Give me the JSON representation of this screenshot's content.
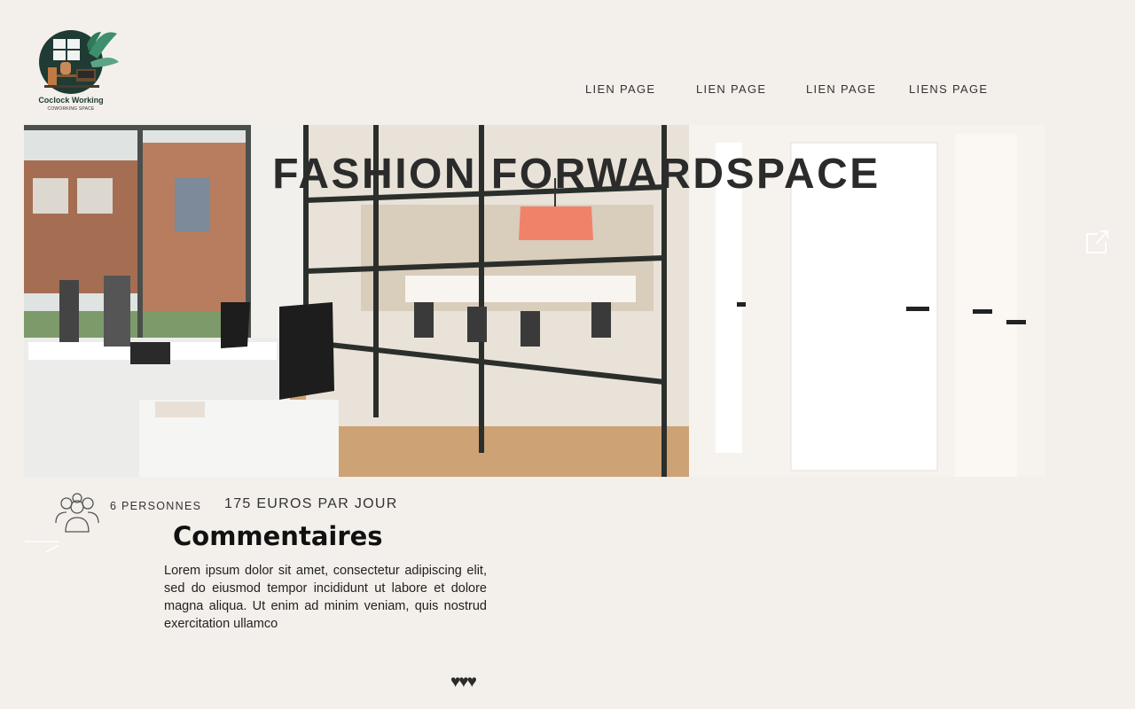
{
  "brand": {
    "logo_icon": "coworking-desk-logo",
    "name": "Coclock Working",
    "tagline": "COWORKING SPACE",
    "color": "#1f3b33"
  },
  "nav": {
    "links": [
      {
        "label": "LIEN PAGE"
      },
      {
        "label": "LIEN PAGE"
      },
      {
        "label": "LIEN PAGE"
      },
      {
        "label": "LIENS PAGE"
      }
    ]
  },
  "hero": {
    "title": "FASHION FORWARDSPACE",
    "image_icon": "office-meeting-room-photo"
  },
  "share": {
    "icon": "external-link-icon"
  },
  "details": {
    "capacity_icon": "people-group-icon",
    "capacity": "6 PERSONNES",
    "price": "175 EUROS PAR JOUR"
  },
  "comments": {
    "title": "Commentaires",
    "body": "Lorem ipsum dolor sit amet, consectetur adipiscing elit, sed do eiusmod tempor incididunt ut labore et dolore magna aliqua. Ut enim ad minim veniam, quis nostrud exercitation ullamco",
    "rating": "♥♥♥",
    "rating_value": 3
  },
  "colors": {
    "background": "#f3efea",
    "text": "#2b2b2b",
    "accent_lamp": "#f0826a"
  }
}
